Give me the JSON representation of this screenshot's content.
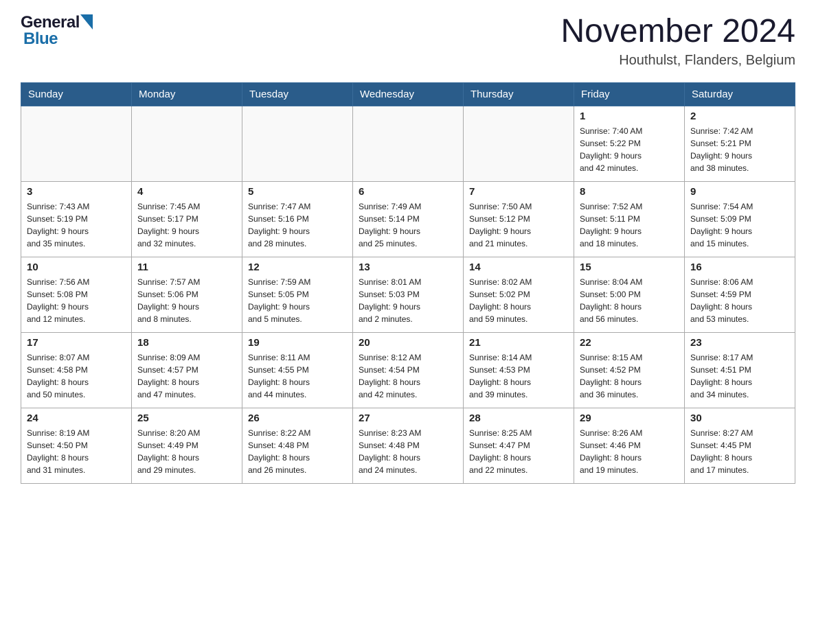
{
  "logo": {
    "general": "General",
    "blue": "Blue"
  },
  "title": "November 2024",
  "location": "Houthulst, Flanders, Belgium",
  "weekdays": [
    "Sunday",
    "Monday",
    "Tuesday",
    "Wednesday",
    "Thursday",
    "Friday",
    "Saturday"
  ],
  "weeks": [
    [
      {
        "day": "",
        "info": ""
      },
      {
        "day": "",
        "info": ""
      },
      {
        "day": "",
        "info": ""
      },
      {
        "day": "",
        "info": ""
      },
      {
        "day": "",
        "info": ""
      },
      {
        "day": "1",
        "info": "Sunrise: 7:40 AM\nSunset: 5:22 PM\nDaylight: 9 hours\nand 42 minutes."
      },
      {
        "day": "2",
        "info": "Sunrise: 7:42 AM\nSunset: 5:21 PM\nDaylight: 9 hours\nand 38 minutes."
      }
    ],
    [
      {
        "day": "3",
        "info": "Sunrise: 7:43 AM\nSunset: 5:19 PM\nDaylight: 9 hours\nand 35 minutes."
      },
      {
        "day": "4",
        "info": "Sunrise: 7:45 AM\nSunset: 5:17 PM\nDaylight: 9 hours\nand 32 minutes."
      },
      {
        "day": "5",
        "info": "Sunrise: 7:47 AM\nSunset: 5:16 PM\nDaylight: 9 hours\nand 28 minutes."
      },
      {
        "day": "6",
        "info": "Sunrise: 7:49 AM\nSunset: 5:14 PM\nDaylight: 9 hours\nand 25 minutes."
      },
      {
        "day": "7",
        "info": "Sunrise: 7:50 AM\nSunset: 5:12 PM\nDaylight: 9 hours\nand 21 minutes."
      },
      {
        "day": "8",
        "info": "Sunrise: 7:52 AM\nSunset: 5:11 PM\nDaylight: 9 hours\nand 18 minutes."
      },
      {
        "day": "9",
        "info": "Sunrise: 7:54 AM\nSunset: 5:09 PM\nDaylight: 9 hours\nand 15 minutes."
      }
    ],
    [
      {
        "day": "10",
        "info": "Sunrise: 7:56 AM\nSunset: 5:08 PM\nDaylight: 9 hours\nand 12 minutes."
      },
      {
        "day": "11",
        "info": "Sunrise: 7:57 AM\nSunset: 5:06 PM\nDaylight: 9 hours\nand 8 minutes."
      },
      {
        "day": "12",
        "info": "Sunrise: 7:59 AM\nSunset: 5:05 PM\nDaylight: 9 hours\nand 5 minutes."
      },
      {
        "day": "13",
        "info": "Sunrise: 8:01 AM\nSunset: 5:03 PM\nDaylight: 9 hours\nand 2 minutes."
      },
      {
        "day": "14",
        "info": "Sunrise: 8:02 AM\nSunset: 5:02 PM\nDaylight: 8 hours\nand 59 minutes."
      },
      {
        "day": "15",
        "info": "Sunrise: 8:04 AM\nSunset: 5:00 PM\nDaylight: 8 hours\nand 56 minutes."
      },
      {
        "day": "16",
        "info": "Sunrise: 8:06 AM\nSunset: 4:59 PM\nDaylight: 8 hours\nand 53 minutes."
      }
    ],
    [
      {
        "day": "17",
        "info": "Sunrise: 8:07 AM\nSunset: 4:58 PM\nDaylight: 8 hours\nand 50 minutes."
      },
      {
        "day": "18",
        "info": "Sunrise: 8:09 AM\nSunset: 4:57 PM\nDaylight: 8 hours\nand 47 minutes."
      },
      {
        "day": "19",
        "info": "Sunrise: 8:11 AM\nSunset: 4:55 PM\nDaylight: 8 hours\nand 44 minutes."
      },
      {
        "day": "20",
        "info": "Sunrise: 8:12 AM\nSunset: 4:54 PM\nDaylight: 8 hours\nand 42 minutes."
      },
      {
        "day": "21",
        "info": "Sunrise: 8:14 AM\nSunset: 4:53 PM\nDaylight: 8 hours\nand 39 minutes."
      },
      {
        "day": "22",
        "info": "Sunrise: 8:15 AM\nSunset: 4:52 PM\nDaylight: 8 hours\nand 36 minutes."
      },
      {
        "day": "23",
        "info": "Sunrise: 8:17 AM\nSunset: 4:51 PM\nDaylight: 8 hours\nand 34 minutes."
      }
    ],
    [
      {
        "day": "24",
        "info": "Sunrise: 8:19 AM\nSunset: 4:50 PM\nDaylight: 8 hours\nand 31 minutes."
      },
      {
        "day": "25",
        "info": "Sunrise: 8:20 AM\nSunset: 4:49 PM\nDaylight: 8 hours\nand 29 minutes."
      },
      {
        "day": "26",
        "info": "Sunrise: 8:22 AM\nSunset: 4:48 PM\nDaylight: 8 hours\nand 26 minutes."
      },
      {
        "day": "27",
        "info": "Sunrise: 8:23 AM\nSunset: 4:48 PM\nDaylight: 8 hours\nand 24 minutes."
      },
      {
        "day": "28",
        "info": "Sunrise: 8:25 AM\nSunset: 4:47 PM\nDaylight: 8 hours\nand 22 minutes."
      },
      {
        "day": "29",
        "info": "Sunrise: 8:26 AM\nSunset: 4:46 PM\nDaylight: 8 hours\nand 19 minutes."
      },
      {
        "day": "30",
        "info": "Sunrise: 8:27 AM\nSunset: 4:45 PM\nDaylight: 8 hours\nand 17 minutes."
      }
    ]
  ]
}
